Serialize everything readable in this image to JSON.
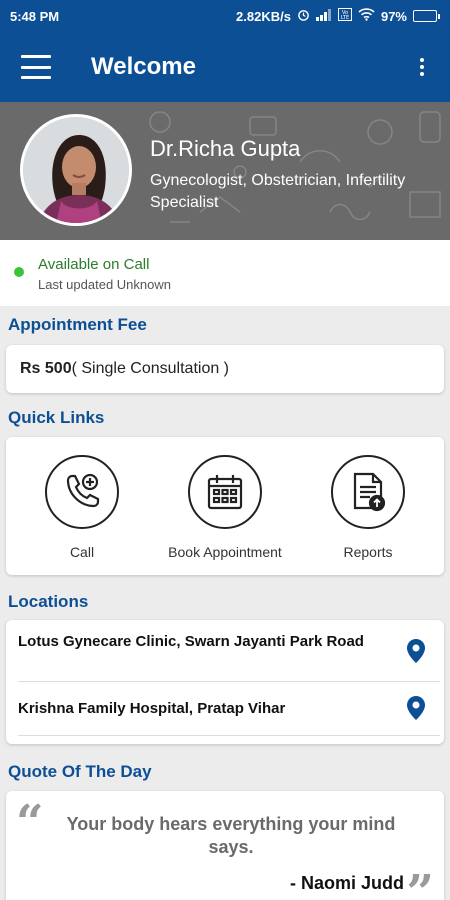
{
  "status_bar": {
    "time": "5:48 PM",
    "network_speed": "2.82KB/s",
    "battery": "97%",
    "battery_level": 0.97,
    "icons": [
      "alarm-icon",
      "signal-icon",
      "volte-icon",
      "wifi-icon",
      "battery-icon"
    ]
  },
  "app_bar": {
    "title": "Welcome",
    "menu_icon": "hamburger-menu-icon",
    "overflow_icon": "more-vert-icon"
  },
  "profile": {
    "name": "Dr.Richa Gupta",
    "specialty": "Gynecologist, Obstetrician, Infertility Specialist"
  },
  "availability": {
    "status": "Available on Call",
    "updated": "Last updated Unknown",
    "status_color": "#3ec23e"
  },
  "appointment_fee": {
    "heading": "Appointment Fee",
    "amount": "Rs 500",
    "note": "( Single Consultation )"
  },
  "quick_links": {
    "heading": "Quick Links",
    "items": [
      {
        "label": "Call",
        "icon": "phone-add-icon"
      },
      {
        "label": "Book Appointment",
        "icon": "calendar-icon"
      },
      {
        "label": "Reports",
        "icon": "report-upload-icon"
      }
    ]
  },
  "locations": {
    "heading": "Locations",
    "items": [
      {
        "name": "Lotus Gynecare Clinic, Swarn Jayanti Park Road",
        "icon": "location-pin-icon"
      },
      {
        "name": "Krishna Family Hospital, Pratap Vihar",
        "icon": "location-pin-icon"
      }
    ]
  },
  "quote": {
    "heading": "Quote Of The Day",
    "text": "Your body hears everything your mind says.",
    "author": "- Naomi Judd"
  },
  "colors": {
    "primary": "#0d4f94",
    "available": "#3ec23e",
    "pin": "#0d4f94"
  }
}
